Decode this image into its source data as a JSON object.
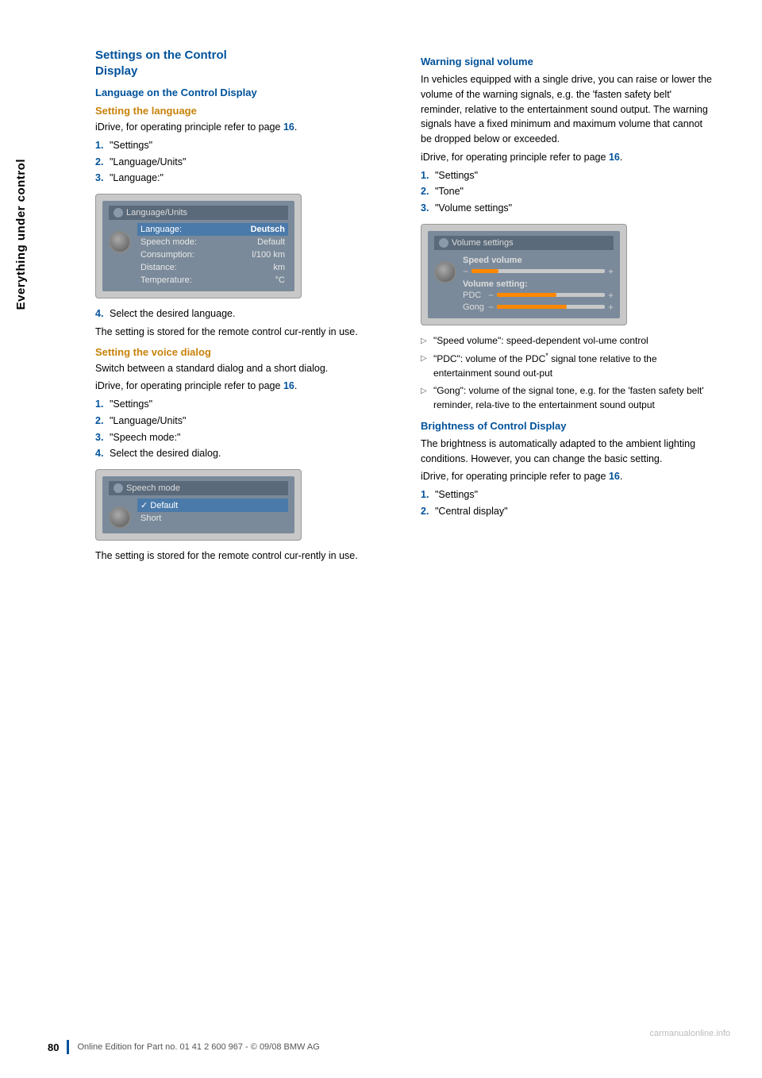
{
  "sidebar": {
    "label": "Everything under control"
  },
  "left_column": {
    "main_title_line1": "Settings on the Control",
    "main_title_line2": "Display",
    "subsection1_title": "Language on the Control Display",
    "setting_language_title": "Setting the language",
    "setting_language_intro": "iDrive, for operating principle refer to page",
    "setting_language_page_ref": "16",
    "setting_language_steps": [
      {
        "num": "1.",
        "text": "\"Settings\""
      },
      {
        "num": "2.",
        "text": "\"Language/Units\""
      },
      {
        "num": "3.",
        "text": "\"Language:\""
      }
    ],
    "step4_text": "Select the desired language.",
    "stored_text": "The setting is stored for the remote control cur-rently in use.",
    "screen1": {
      "title": "Language/Units",
      "rows": [
        {
          "label": "Language:",
          "value": "Deutsch",
          "highlight": true
        },
        {
          "label": "Speech mode:",
          "value": "Default"
        },
        {
          "label": "Consumption:",
          "value": "l/100 km"
        },
        {
          "label": "Distance:",
          "value": "km"
        },
        {
          "label": "Temperature:",
          "value": "°C"
        }
      ]
    },
    "voice_dialog_title": "Setting the voice dialog",
    "voice_dialog_intro": "Switch between a standard dialog and a short dialog.",
    "voice_dialog_idrive": "iDrive, for operating principle refer to page",
    "voice_dialog_page_ref": "16",
    "voice_dialog_steps": [
      {
        "num": "1.",
        "text": "\"Settings\""
      },
      {
        "num": "2.",
        "text": "\"Language/Units\""
      },
      {
        "num": "3.",
        "text": "\"Speech mode:\""
      },
      {
        "num": "4.",
        "text": "Select the desired dialog."
      }
    ],
    "screen2": {
      "title": "Speech mode",
      "rows": [
        {
          "label": "Default",
          "selected": true,
          "checkmark": true
        },
        {
          "label": "Short",
          "selected": false
        }
      ]
    },
    "stored_text2": "The setting is stored for the remote control cur-rently in use."
  },
  "right_column": {
    "warning_title": "Warning signal volume",
    "warning_para1": "In vehicles equipped with a single drive, you can raise or lower the volume of the warning signals, e.g. the 'fasten safety belt' reminder, relative to the entertainment sound output. The warning signals have a fixed minimum and maximum volume that cannot be dropped below or exceeded.",
    "warning_idrive": "iDrive, for operating principle refer to page",
    "warning_page_ref": "16",
    "warning_steps": [
      {
        "num": "1.",
        "text": "\"Settings\""
      },
      {
        "num": "2.",
        "text": "\"Tone\""
      },
      {
        "num": "3.",
        "text": "\"Volume settings\""
      }
    ],
    "volume_screen": {
      "title": "Volume settings",
      "speed_volume_label": "Speed volume",
      "volume_setting_label": "Volume setting:",
      "pdc_label": "PDC",
      "gong_label": "Gong"
    },
    "bullets": [
      "\"Speed volume\": speed-dependent vol-ume control",
      "\"PDC\": volume of the PDC* signal tone relative to the entertainment sound out-put",
      "\"Gong\": volume of the signal tone, e.g. for the 'fasten safety belt' reminder, rela-tive to the entertainment sound output"
    ],
    "brightness_title": "Brightness of Control Display",
    "brightness_para": "The brightness is automatically adapted to the ambient lighting conditions. However, you can change the basic setting.",
    "brightness_idrive": "iDrive, for operating principle refer to page",
    "brightness_page_ref": "16",
    "brightness_steps": [
      {
        "num": "1.",
        "text": "\"Settings\""
      },
      {
        "num": "2.",
        "text": "\"Central display\""
      }
    ]
  },
  "footer": {
    "page_number": "80",
    "footer_text": "Online Edition for Part no. 01 41 2 600 967  - © 09/08 BMW AG"
  },
  "watermark": "carmanualonline.info"
}
